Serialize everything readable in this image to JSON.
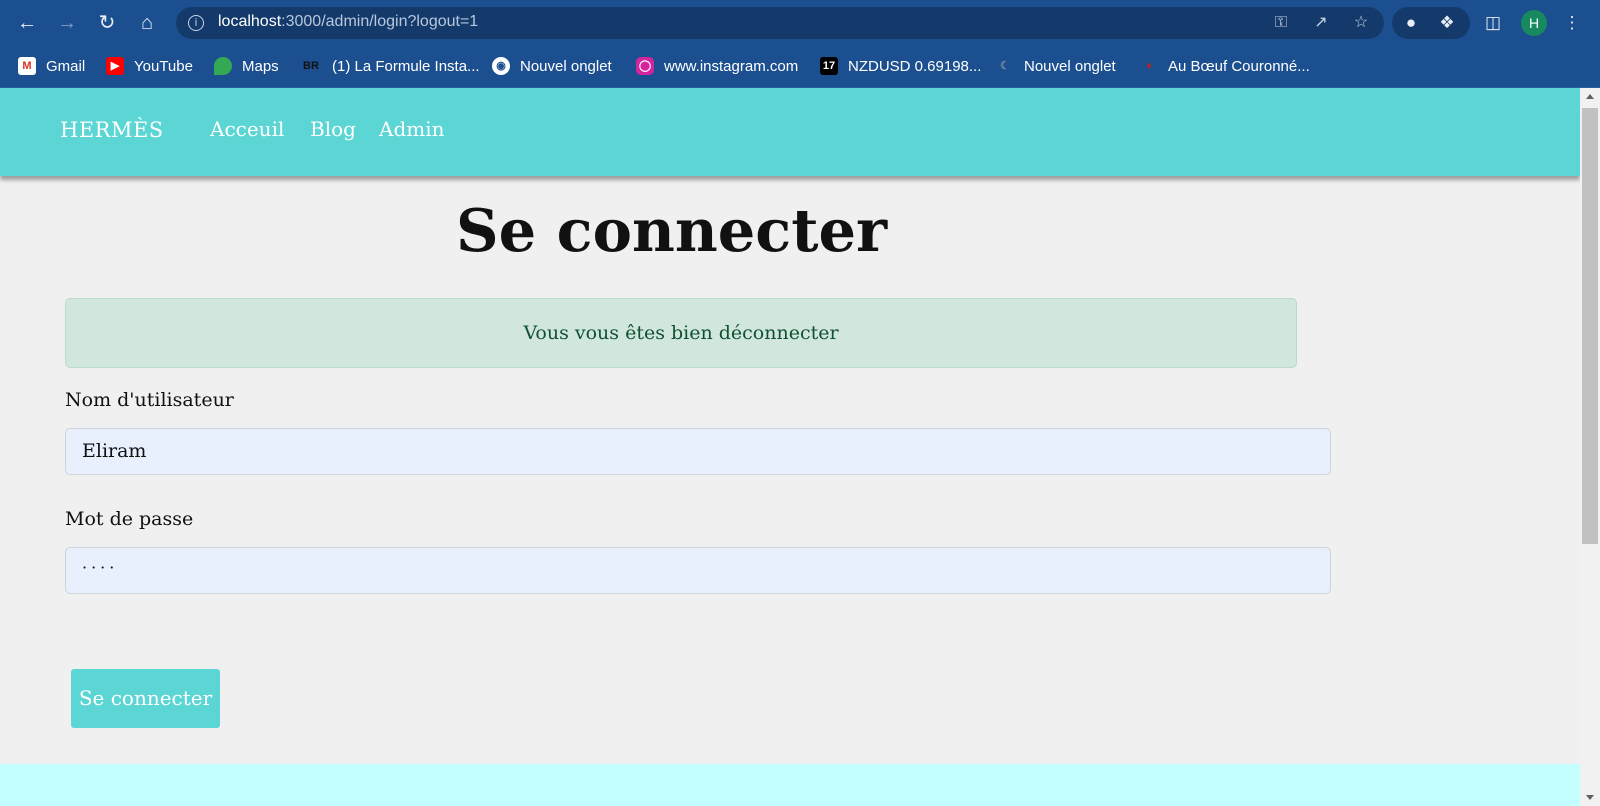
{
  "browser": {
    "url_host": "localhost",
    "url_rest": ":3000/admin/login?logout=1",
    "avatar_letter": "H",
    "bookmarks": [
      {
        "label": "Gmail",
        "icon": "gmail-icon"
      },
      {
        "label": "YouTube",
        "icon": "youtube-icon"
      },
      {
        "label": "Maps",
        "icon": "maps-icon"
      },
      {
        "label": "(1) La Formule Insta...",
        "icon": "br-icon",
        "icon_text": "BR"
      },
      {
        "label": "Nouvel onglet",
        "icon": "globe-icon"
      },
      {
        "label": "www.instagram.com",
        "icon": "instagram-icon"
      },
      {
        "label": "NZDUSD 0.69198...",
        "icon": "tradingview-icon",
        "icon_text": "17"
      },
      {
        "label": "Nouvel onglet",
        "icon": "moon-icon"
      },
      {
        "label": "Au Bœuf Couronné...",
        "icon": "boeuf-icon"
      }
    ]
  },
  "site": {
    "brand": "HERMÈS",
    "nav": [
      "Acceuil",
      "Blog",
      "Admin"
    ]
  },
  "login": {
    "title": "Se connecter",
    "alert": "Vous vous êtes bien déconnecter",
    "username_label": "Nom d'utilisateur",
    "username_value": "Eliram",
    "password_label": "Mot de passe",
    "password_value": "····",
    "submit_label": "Se connecter"
  },
  "colors": {
    "accent": "#5cd6d4",
    "alert_bg": "#d1e7dd",
    "alert_text": "#0f5132",
    "footer": "#c4ffff",
    "chrome": "#1b4f8f"
  }
}
